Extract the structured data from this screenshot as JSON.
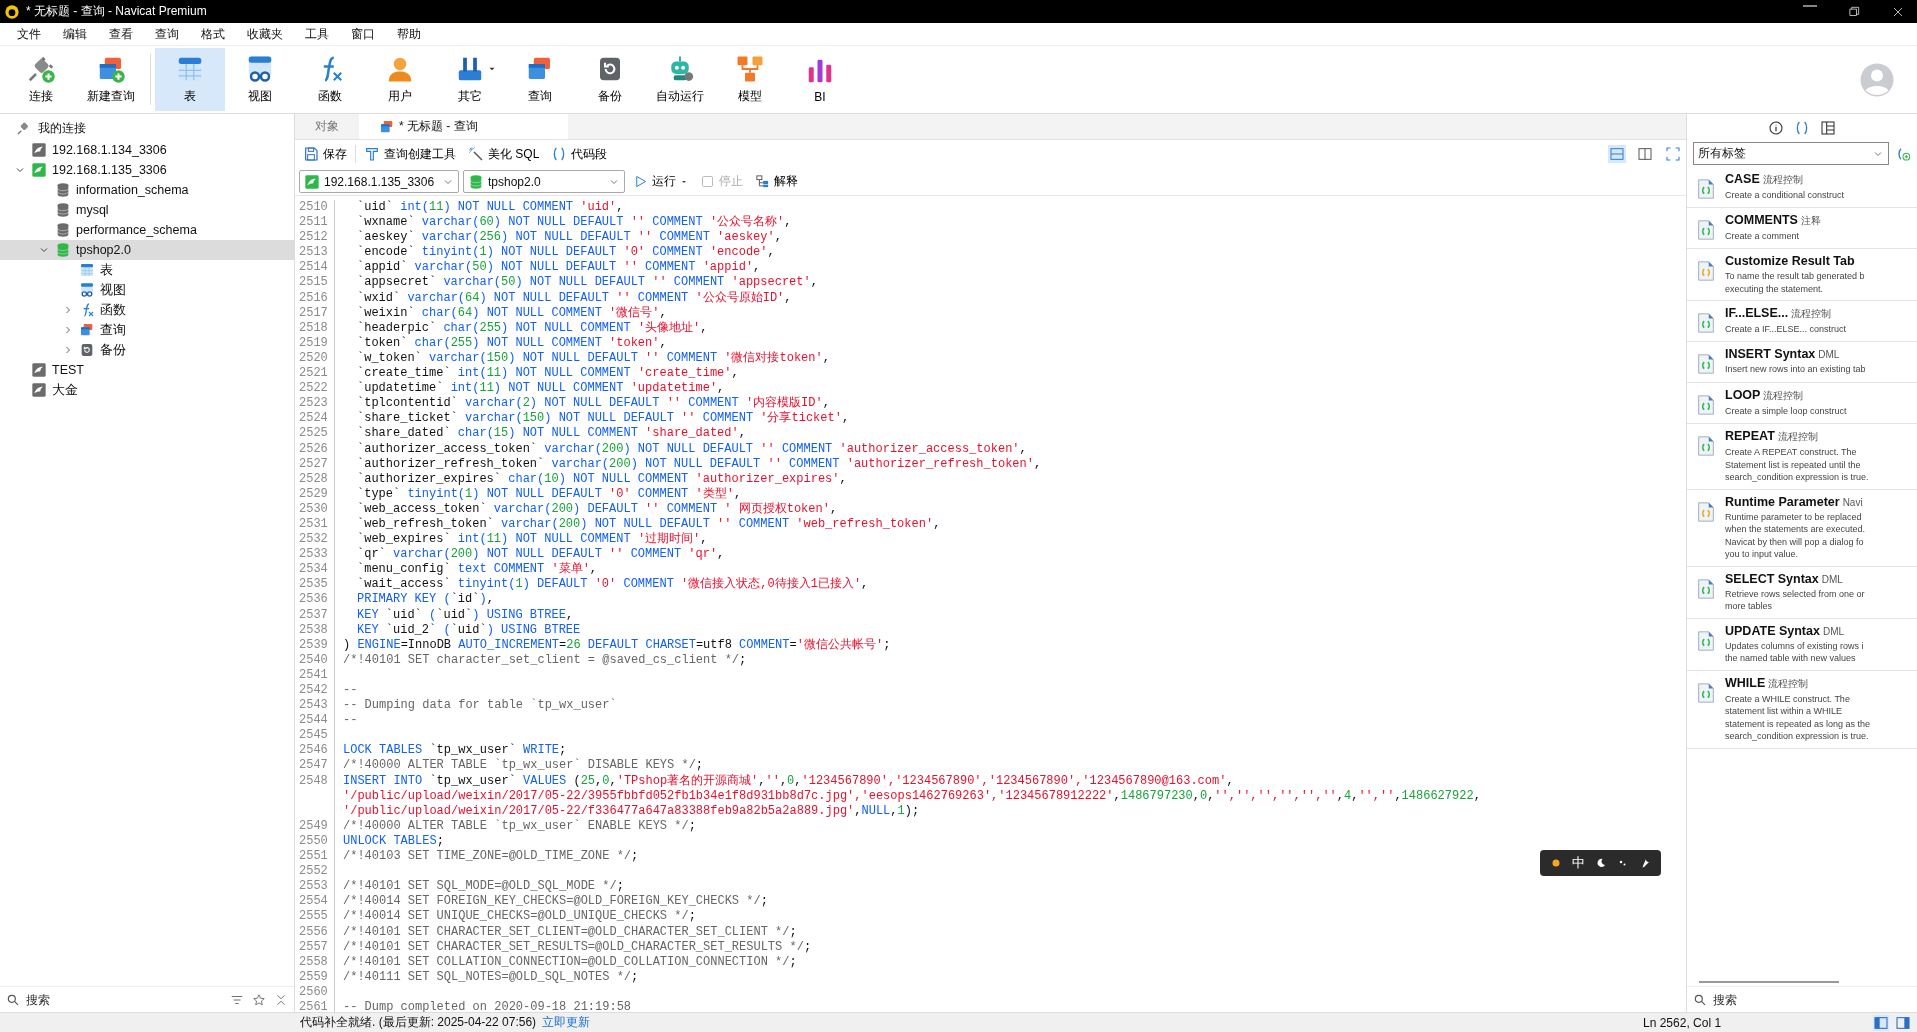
{
  "window": {
    "title": "* 无标题 - 查询 - Navicat Premium"
  },
  "menu": [
    "文件",
    "编辑",
    "查看",
    "查询",
    "格式",
    "收藏夹",
    "工具",
    "窗口",
    "帮助"
  ],
  "toolbar": [
    {
      "label": "连接",
      "kind": "connect",
      "selected": false,
      "dropdown": false
    },
    {
      "label": "新建查询",
      "kind": "new-query",
      "selected": false,
      "dropdown": false
    },
    {
      "label": "表",
      "kind": "table",
      "selected": true,
      "dropdown": false
    },
    {
      "label": "视图",
      "kind": "view",
      "selected": false,
      "dropdown": false
    },
    {
      "label": "函数",
      "kind": "function",
      "selected": false,
      "dropdown": false
    },
    {
      "label": "用户",
      "kind": "user",
      "selected": false,
      "dropdown": false
    },
    {
      "label": "其它",
      "kind": "other",
      "selected": false,
      "dropdown": true
    },
    {
      "label": "查询",
      "kind": "query",
      "selected": false,
      "dropdown": false
    },
    {
      "label": "备份",
      "kind": "backup",
      "selected": false,
      "dropdown": false
    },
    {
      "label": "自动运行",
      "kind": "automation",
      "selected": false,
      "dropdown": false
    },
    {
      "label": "模型",
      "kind": "model",
      "selected": false,
      "dropdown": false
    },
    {
      "label": "BI",
      "kind": "bi",
      "selected": false,
      "dropdown": false
    }
  ],
  "navigator": {
    "title": "我的连接",
    "items": [
      {
        "label": "192.168.1.134_3306",
        "kind": "server",
        "open": false,
        "selected": false
      },
      {
        "label": "192.168.1.135_3306",
        "kind": "server",
        "open": true,
        "selected": false,
        "expanded": true,
        "children": [
          {
            "label": "information_schema",
            "kind": "database",
            "open": false,
            "selected": false
          },
          {
            "label": "mysql",
            "kind": "database",
            "open": false,
            "selected": false
          },
          {
            "label": "performance_schema",
            "kind": "database",
            "open": false,
            "selected": false
          },
          {
            "label": "tpshop2.0",
            "kind": "database",
            "open": true,
            "selected": true,
            "expanded": true,
            "children": [
              {
                "label": "表",
                "kind": "table",
                "selected": false
              },
              {
                "label": "视图",
                "kind": "view",
                "selected": false
              },
              {
                "label": "函数",
                "kind": "function",
                "selected": false,
                "expanded": false
              },
              {
                "label": "查询",
                "kind": "query",
                "selected": false,
                "expanded": false
              },
              {
                "label": "备份",
                "kind": "backup",
                "selected": false,
                "expanded": false
              }
            ]
          }
        ]
      },
      {
        "label": "TEST",
        "kind": "server",
        "open": false,
        "selected": false
      },
      {
        "label": "大金",
        "kind": "server",
        "open": false,
        "selected": false
      }
    ],
    "search": {
      "placeholder": "搜索"
    }
  },
  "tabs": [
    {
      "label": "对象",
      "kind": "objects",
      "selected": false
    },
    {
      "label": "* 无标题 - 查询",
      "kind": "query",
      "selected": true
    }
  ],
  "editor_toolbar": [
    {
      "label": "保存",
      "kind": "save"
    },
    {
      "label": "查询创建工具",
      "kind": "builder"
    },
    {
      "label": "美化 SQL",
      "kind": "beautify"
    },
    {
      "label": "代码段",
      "kind": "snippet"
    }
  ],
  "connection_bar": {
    "connection": "192.168.1.135_3306",
    "database": "tpshop2.0",
    "run": "运行",
    "stop": {
      "label": "停止",
      "disabled": true
    },
    "explain": "解释"
  },
  "code": [
    {
      "number": "2510",
      "indent": true,
      "tokens": [
        {
          "kind": "plain",
          "text": "`uid` "
        },
        {
          "kind": "keyword",
          "text": "int("
        },
        {
          "kind": "number",
          "text": "11"
        },
        {
          "kind": "keyword",
          "text": ") NOT NULL COMMENT "
        },
        {
          "kind": "string",
          "text": "'uid'"
        },
        {
          "kind": "plain",
          "text": ","
        }
      ]
    },
    {
      "number": "2511",
      "indent": true,
      "tokens": [
        {
          "kind": "plain",
          "text": "`wxname` "
        },
        {
          "kind": "keyword",
          "text": "varchar("
        },
        {
          "kind": "number",
          "text": "60"
        },
        {
          "kind": "keyword",
          "text": ") NOT NULL DEFAULT "
        },
        {
          "kind": "string",
          "text": "''"
        },
        {
          "kind": "keyword",
          "text": " COMMENT "
        },
        {
          "kind": "string",
          "text": "'公众号名称'"
        },
        {
          "kind": "plain",
          "text": ","
        }
      ]
    },
    {
      "number": "2512",
      "indent": true,
      "tokens": [
        {
          "kind": "plain",
          "text": "`aeskey` "
        },
        {
          "kind": "keyword",
          "text": "varchar("
        },
        {
          "kind": "number",
          "text": "256"
        },
        {
          "kind": "keyword",
          "text": ") NOT NULL DEFAULT "
        },
        {
          "kind": "string",
          "text": "''"
        },
        {
          "kind": "keyword",
          "text": " COMMENT "
        },
        {
          "kind": "string",
          "text": "'aeskey'"
        },
        {
          "kind": "plain",
          "text": ","
        }
      ]
    },
    {
      "number": "2513",
      "indent": true,
      "tokens": [
        {
          "kind": "plain",
          "text": "`encode` "
        },
        {
          "kind": "keyword",
          "text": "tinyint("
        },
        {
          "kind": "number",
          "text": "1"
        },
        {
          "kind": "keyword",
          "text": ") NOT NULL DEFAULT "
        },
        {
          "kind": "string",
          "text": "'0'"
        },
        {
          "kind": "keyword",
          "text": " COMMENT "
        },
        {
          "kind": "string",
          "text": "'encode'"
        },
        {
          "kind": "plain",
          "text": ","
        }
      ]
    },
    {
      "number": "2514",
      "indent": true,
      "tokens": [
        {
          "kind": "plain",
          "text": "`appid` "
        },
        {
          "kind": "keyword",
          "text": "varchar("
        },
        {
          "kind": "number",
          "text": "50"
        },
        {
          "kind": "keyword",
          "text": ") NOT NULL DEFAULT "
        },
        {
          "kind": "string",
          "text": "''"
        },
        {
          "kind": "keyword",
          "text": " COMMENT "
        },
        {
          "kind": "string",
          "text": "'appid'"
        },
        {
          "kind": "plain",
          "text": ","
        }
      ]
    },
    {
      "number": "2515",
      "indent": true,
      "tokens": [
        {
          "kind": "plain",
          "text": "`appsecret` "
        },
        {
          "kind": "keyword",
          "text": "varchar("
        },
        {
          "kind": "number",
          "text": "50"
        },
        {
          "kind": "keyword",
          "text": ") NOT NULL DEFAULT "
        },
        {
          "kind": "string",
          "text": "''"
        },
        {
          "kind": "keyword",
          "text": " COMMENT "
        },
        {
          "kind": "string",
          "text": "'appsecret'"
        },
        {
          "kind": "plain",
          "text": ","
        }
      ]
    },
    {
      "number": "2516",
      "indent": true,
      "tokens": [
        {
          "kind": "plain",
          "text": "`wxid` "
        },
        {
          "kind": "keyword",
          "text": "varchar("
        },
        {
          "kind": "number",
          "text": "64"
        },
        {
          "kind": "keyword",
          "text": ") NOT NULL DEFAULT "
        },
        {
          "kind": "string",
          "text": "''"
        },
        {
          "kind": "keyword",
          "text": " COMMENT "
        },
        {
          "kind": "string",
          "text": "'公众号原始ID'"
        },
        {
          "kind": "plain",
          "text": ","
        }
      ]
    },
    {
      "number": "2517",
      "indent": true,
      "tokens": [
        {
          "kind": "plain",
          "text": "`weixin` "
        },
        {
          "kind": "keyword",
          "text": "char("
        },
        {
          "kind": "number",
          "text": "64"
        },
        {
          "kind": "keyword",
          "text": ") NOT NULL COMMENT "
        },
        {
          "kind": "string",
          "text": "'微信号'"
        },
        {
          "kind": "plain",
          "text": ","
        }
      ]
    },
    {
      "number": "2518",
      "indent": true,
      "tokens": [
        {
          "kind": "plain",
          "text": "`headerpic` "
        },
        {
          "kind": "keyword",
          "text": "char("
        },
        {
          "kind": "number",
          "text": "255"
        },
        {
          "kind": "keyword",
          "text": ") NOT NULL COMMENT "
        },
        {
          "kind": "string",
          "text": "'头像地址'"
        },
        {
          "kind": "plain",
          "text": ","
        }
      ]
    },
    {
      "number": "2519",
      "indent": true,
      "tokens": [
        {
          "kind": "plain",
          "text": "`token` "
        },
        {
          "kind": "keyword",
          "text": "char("
        },
        {
          "kind": "number",
          "text": "255"
        },
        {
          "kind": "keyword",
          "text": ") NOT NULL COMMENT "
        },
        {
          "kind": "string",
          "text": "'token'"
        },
        {
          "kind": "plain",
          "text": ","
        }
      ]
    },
    {
      "number": "2520",
      "indent": true,
      "tokens": [
        {
          "kind": "plain",
          "text": "`w_token` "
        },
        {
          "kind": "keyword",
          "text": "varchar("
        },
        {
          "kind": "number",
          "text": "150"
        },
        {
          "kind": "keyword",
          "text": ") NOT NULL DEFAULT "
        },
        {
          "kind": "string",
          "text": "''"
        },
        {
          "kind": "keyword",
          "text": " COMMENT "
        },
        {
          "kind": "string",
          "text": "'微信对接token'"
        },
        {
          "kind": "plain",
          "text": ","
        }
      ]
    },
    {
      "number": "2521",
      "indent": true,
      "tokens": [
        {
          "kind": "plain",
          "text": "`create_time` "
        },
        {
          "kind": "keyword",
          "text": "int("
        },
        {
          "kind": "number",
          "text": "11"
        },
        {
          "kind": "keyword",
          "text": ") NOT NULL COMMENT "
        },
        {
          "kind": "string",
          "text": "'create_time'"
        },
        {
          "kind": "plain",
          "text": ","
        }
      ]
    },
    {
      "number": "2522",
      "indent": true,
      "tokens": [
        {
          "kind": "plain",
          "text": "`updatetime` "
        },
        {
          "kind": "keyword",
          "text": "int("
        },
        {
          "kind": "number",
          "text": "11"
        },
        {
          "kind": "keyword",
          "text": ") NOT NULL COMMENT "
        },
        {
          "kind": "string",
          "text": "'updatetime'"
        },
        {
          "kind": "plain",
          "text": ","
        }
      ]
    },
    {
      "number": "2523",
      "indent": true,
      "tokens": [
        {
          "kind": "plain",
          "text": "`tplcontentid` "
        },
        {
          "kind": "keyword",
          "text": "varchar("
        },
        {
          "kind": "number",
          "text": "2"
        },
        {
          "kind": "keyword",
          "text": ") NOT NULL DEFAULT "
        },
        {
          "kind": "string",
          "text": "''"
        },
        {
          "kind": "keyword",
          "text": " COMMENT "
        },
        {
          "kind": "string",
          "text": "'内容模版ID'"
        },
        {
          "kind": "plain",
          "text": ","
        }
      ]
    },
    {
      "number": "2524",
      "indent": true,
      "tokens": [
        {
          "kind": "plain",
          "text": "`share_ticket` "
        },
        {
          "kind": "keyword",
          "text": "varchar("
        },
        {
          "kind": "number",
          "text": "150"
        },
        {
          "kind": "keyword",
          "text": ") NOT NULL DEFAULT "
        },
        {
          "kind": "string",
          "text": "''"
        },
        {
          "kind": "keyword",
          "text": " COMMENT "
        },
        {
          "kind": "string",
          "text": "'分享ticket'"
        },
        {
          "kind": "plain",
          "text": ","
        }
      ]
    },
    {
      "number": "2525",
      "indent": true,
      "tokens": [
        {
          "kind": "plain",
          "text": "`share_dated` "
        },
        {
          "kind": "keyword",
          "text": "char("
        },
        {
          "kind": "number",
          "text": "15"
        },
        {
          "kind": "keyword",
          "text": ") NOT NULL COMMENT "
        },
        {
          "kind": "string",
          "text": "'share_dated'"
        },
        {
          "kind": "plain",
          "text": ","
        }
      ]
    },
    {
      "number": "2526",
      "indent": true,
      "tokens": [
        {
          "kind": "plain",
          "text": "`authorizer_access_token` "
        },
        {
          "kind": "keyword",
          "text": "varchar("
        },
        {
          "kind": "number",
          "text": "200"
        },
        {
          "kind": "keyword",
          "text": ") NOT NULL DEFAULT "
        },
        {
          "kind": "string",
          "text": "''"
        },
        {
          "kind": "keyword",
          "text": " COMMENT "
        },
        {
          "kind": "string",
          "text": "'authorizer_access_token'"
        },
        {
          "kind": "plain",
          "text": ","
        }
      ]
    },
    {
      "number": "2527",
      "indent": true,
      "tokens": [
        {
          "kind": "plain",
          "text": "`authorizer_refresh_token` "
        },
        {
          "kind": "keyword",
          "text": "varchar("
        },
        {
          "kind": "number",
          "text": "200"
        },
        {
          "kind": "keyword",
          "text": ") NOT NULL DEFAULT "
        },
        {
          "kind": "string",
          "text": "''"
        },
        {
          "kind": "keyword",
          "text": " COMMENT "
        },
        {
          "kind": "string",
          "text": "'authorizer_refresh_token'"
        },
        {
          "kind": "plain",
          "text": ","
        }
      ]
    },
    {
      "number": "2528",
      "indent": true,
      "tokens": [
        {
          "kind": "plain",
          "text": "`authorizer_expires` "
        },
        {
          "kind": "keyword",
          "text": "char("
        },
        {
          "kind": "number",
          "text": "10"
        },
        {
          "kind": "keyword",
          "text": ") NOT NULL COMMENT "
        },
        {
          "kind": "string",
          "text": "'authorizer_expires'"
        },
        {
          "kind": "plain",
          "text": ","
        }
      ]
    },
    {
      "number": "2529",
      "indent": true,
      "tokens": [
        {
          "kind": "plain",
          "text": "`type` "
        },
        {
          "kind": "keyword",
          "text": "tinyint("
        },
        {
          "kind": "number",
          "text": "1"
        },
        {
          "kind": "keyword",
          "text": ") NOT NULL DEFAULT "
        },
        {
          "kind": "string",
          "text": "'0'"
        },
        {
          "kind": "keyword",
          "text": " COMMENT "
        },
        {
          "kind": "string",
          "text": "'类型'"
        },
        {
          "kind": "plain",
          "text": ","
        }
      ]
    },
    {
      "number": "2530",
      "indent": true,
      "tokens": [
        {
          "kind": "plain",
          "text": "`web_access_token` "
        },
        {
          "kind": "keyword",
          "text": "varchar("
        },
        {
          "kind": "number",
          "text": "200"
        },
        {
          "kind": "keyword",
          "text": ") DEFAULT "
        },
        {
          "kind": "string",
          "text": "''"
        },
        {
          "kind": "keyword",
          "text": " COMMENT "
        },
        {
          "kind": "string",
          "text": "' 网页授权token'"
        },
        {
          "kind": "plain",
          "text": ","
        }
      ]
    },
    {
      "number": "2531",
      "indent": true,
      "tokens": [
        {
          "kind": "plain",
          "text": "`web_refresh_token` "
        },
        {
          "kind": "keyword",
          "text": "varchar("
        },
        {
          "kind": "number",
          "text": "200"
        },
        {
          "kind": "keyword",
          "text": ") NOT NULL DEFAULT "
        },
        {
          "kind": "string",
          "text": "''"
        },
        {
          "kind": "keyword",
          "text": " COMMENT "
        },
        {
          "kind": "string",
          "text": "'web_refresh_token'"
        },
        {
          "kind": "plain",
          "text": ","
        }
      ]
    },
    {
      "number": "2532",
      "indent": true,
      "tokens": [
        {
          "kind": "plain",
          "text": "`web_expires` "
        },
        {
          "kind": "keyword",
          "text": "int("
        },
        {
          "kind": "number",
          "text": "11"
        },
        {
          "kind": "keyword",
          "text": ") NOT NULL COMMENT "
        },
        {
          "kind": "string",
          "text": "'过期时间'"
        },
        {
          "kind": "plain",
          "text": ","
        }
      ]
    },
    {
      "number": "2533",
      "indent": true,
      "tokens": [
        {
          "kind": "plain",
          "text": "`qr` "
        },
        {
          "kind": "keyword",
          "text": "varchar("
        },
        {
          "kind": "number",
          "text": "200"
        },
        {
          "kind": "keyword",
          "text": ") NOT NULL DEFAULT "
        },
        {
          "kind": "string",
          "text": "''"
        },
        {
          "kind": "keyword",
          "text": " COMMENT "
        },
        {
          "kind": "string",
          "text": "'qr'"
        },
        {
          "kind": "plain",
          "text": ","
        }
      ]
    },
    {
      "number": "2534",
      "indent": true,
      "tokens": [
        {
          "kind": "plain",
          "text": "`menu_config` "
        },
        {
          "kind": "keyword",
          "text": "text COMMENT "
        },
        {
          "kind": "string",
          "text": "'菜单'"
        },
        {
          "kind": "plain",
          "text": ","
        }
      ]
    },
    {
      "number": "2535",
      "indent": true,
      "tokens": [
        {
          "kind": "plain",
          "text": "`wait_access` "
        },
        {
          "kind": "keyword",
          "text": "tinyint("
        },
        {
          "kind": "number",
          "text": "1"
        },
        {
          "kind": "keyword",
          "text": ") DEFAULT "
        },
        {
          "kind": "string",
          "text": "'0'"
        },
        {
          "kind": "keyword",
          "text": " COMMENT "
        },
        {
          "kind": "string",
          "text": "'微信接入状态,0待接入1已接入'"
        },
        {
          "kind": "plain",
          "text": ","
        }
      ]
    },
    {
      "number": "2536",
      "indent": true,
      "tokens": [
        {
          "kind": "keyword",
          "text": "PRIMARY KEY ("
        },
        {
          "kind": "plain",
          "text": "`id`"
        },
        {
          "kind": "keyword",
          "text": ")"
        },
        {
          "kind": "plain",
          "text": ","
        }
      ]
    },
    {
      "number": "2537",
      "indent": true,
      "tokens": [
        {
          "kind": "keyword",
          "text": "KEY "
        },
        {
          "kind": "plain",
          "text": "`uid` "
        },
        {
          "kind": "keyword",
          "text": "("
        },
        {
          "kind": "plain",
          "text": "`uid`"
        },
        {
          "kind": "keyword",
          "text": ") USING BTREE"
        },
        {
          "kind": "plain",
          "text": ","
        }
      ]
    },
    {
      "number": "2538",
      "indent": true,
      "tokens": [
        {
          "kind": "keyword",
          "text": "KEY "
        },
        {
          "kind": "plain",
          "text": "`uid_2` "
        },
        {
          "kind": "keyword",
          "text": "("
        },
        {
          "kind": "plain",
          "text": "`uid`"
        },
        {
          "kind": "keyword",
          "text": ") USING BTREE"
        }
      ]
    },
    {
      "number": "2539",
      "indent": false,
      "tokens": [
        {
          "kind": "plain",
          "text": ") "
        },
        {
          "kind": "keyword",
          "text": "ENGINE"
        },
        {
          "kind": "plain",
          "text": "=InnoDB "
        },
        {
          "kind": "keyword",
          "text": "AUTO_INCREMENT"
        },
        {
          "kind": "plain",
          "text": "="
        },
        {
          "kind": "number",
          "text": "26"
        },
        {
          "kind": "keyword",
          "text": " DEFAULT CHARSET"
        },
        {
          "kind": "plain",
          "text": "=utf8 "
        },
        {
          "kind": "keyword",
          "text": "COMMENT"
        },
        {
          "kind": "plain",
          "text": "="
        },
        {
          "kind": "string",
          "text": "'微信公共帐号'"
        },
        {
          "kind": "plain",
          "text": ";"
        }
      ]
    },
    {
      "number": "2540",
      "indent": false,
      "tokens": [
        {
          "kind": "comment",
          "text": "/*!40101 SET character_set_client = @saved_cs_client */"
        },
        {
          "kind": "plain",
          "text": ";"
        }
      ]
    },
    {
      "number": "2541"
    },
    {
      "number": "2542",
      "indent": false,
      "tokens": [
        {
          "kind": "comment",
          "text": "--"
        }
      ]
    },
    {
      "number": "2543",
      "indent": false,
      "tokens": [
        {
          "kind": "comment",
          "text": "-- Dumping data for table `tp_wx_user`"
        }
      ]
    },
    {
      "number": "2544",
      "indent": false,
      "tokens": [
        {
          "kind": "comment",
          "text": "--"
        }
      ]
    },
    {
      "number": "2545"
    },
    {
      "number": "2546",
      "indent": false,
      "tokens": [
        {
          "kind": "keyword",
          "text": "LOCK TABLES "
        },
        {
          "kind": "plain",
          "text": "`tp_wx_user` "
        },
        {
          "kind": "keyword",
          "text": "WRITE"
        },
        {
          "kind": "plain",
          "text": ";"
        }
      ]
    },
    {
      "number": "2547",
      "indent": false,
      "tokens": [
        {
          "kind": "comment",
          "text": "/*!40000 ALTER TABLE `tp_wx_user` DISABLE KEYS */"
        },
        {
          "kind": "plain",
          "text": ";"
        }
      ]
    },
    {
      "number": "2548",
      "indent": false,
      "tokens": [
        {
          "kind": "keyword",
          "text": "INSERT INTO "
        },
        {
          "kind": "plain",
          "text": "`tp_wx_user` "
        },
        {
          "kind": "keyword",
          "text": "VALUES "
        },
        {
          "kind": "plain",
          "text": "("
        },
        {
          "kind": "number",
          "text": "25"
        },
        {
          "kind": "plain",
          "text": ","
        },
        {
          "kind": "number",
          "text": "0"
        },
        {
          "kind": "plain",
          "text": ","
        },
        {
          "kind": "string",
          "text": "'TPshop著名的开源商城'"
        },
        {
          "kind": "plain",
          "text": ","
        },
        {
          "kind": "string",
          "text": "''"
        },
        {
          "kind": "plain",
          "text": ","
        },
        {
          "kind": "number",
          "text": "0"
        },
        {
          "kind": "plain",
          "text": ","
        },
        {
          "kind": "string",
          "text": "'1234567890','1234567890','1234567890','1234567890@163.com'"
        },
        {
          "kind": "plain",
          "text": ","
        }
      ],
      "more": [
        [
          {
            "kind": "string",
            "text": "'/public/upload/weixin/2017/05-22/3955fbbfd052fb1b34e1f8d931bb8d7c.jpg','eesops1462769263','12345678912222'"
          },
          {
            "kind": "plain",
            "text": ","
          },
          {
            "kind": "number",
            "text": "1486797230"
          },
          {
            "kind": "plain",
            "text": ","
          },
          {
            "kind": "number",
            "text": "0"
          },
          {
            "kind": "plain",
            "text": ","
          },
          {
            "kind": "string",
            "text": "'','','','','',''"
          },
          {
            "kind": "plain",
            "text": ","
          },
          {
            "kind": "number",
            "text": "4"
          },
          {
            "kind": "plain",
            "text": ","
          },
          {
            "kind": "string",
            "text": "'',''"
          },
          {
            "kind": "plain",
            "text": ","
          },
          {
            "kind": "number",
            "text": "1486627922"
          },
          {
            "kind": "plain",
            "text": ","
          }
        ],
        [
          {
            "kind": "string",
            "text": "'/public/upload/weixin/2017/05-22/f336477a647a83388feb9a82b5a2a889.jpg'"
          },
          {
            "kind": "plain",
            "text": ","
          },
          {
            "kind": "keyword",
            "text": "NULL"
          },
          {
            "kind": "plain",
            "text": ","
          },
          {
            "kind": "number",
            "text": "1"
          },
          {
            "kind": "plain",
            "text": ");"
          }
        ]
      ]
    },
    {
      "number": "2549",
      "indent": false,
      "tokens": [
        {
          "kind": "comment",
          "text": "/*!40000 ALTER TABLE `tp_wx_user` ENABLE KEYS */"
        },
        {
          "kind": "plain",
          "text": ";"
        }
      ]
    },
    {
      "number": "2550",
      "indent": false,
      "tokens": [
        {
          "kind": "keyword",
          "text": "UNLOCK TABLES"
        },
        {
          "kind": "plain",
          "text": ";"
        }
      ]
    },
    {
      "number": "2551",
      "indent": false,
      "tokens": [
        {
          "kind": "comment",
          "text": "/*!40103 SET TIME_ZONE=@OLD_TIME_ZONE */"
        },
        {
          "kind": "plain",
          "text": ";"
        }
      ]
    },
    {
      "number": "2552"
    },
    {
      "number": "2553",
      "indent": false,
      "tokens": [
        {
          "kind": "comment",
          "text": "/*!40101 SET SQL_MODE=@OLD_SQL_MODE */"
        },
        {
          "kind": "plain",
          "text": ";"
        }
      ]
    },
    {
      "number": "2554",
      "indent": false,
      "tokens": [
        {
          "kind": "comment",
          "text": "/*!40014 SET FOREIGN_KEY_CHECKS=@OLD_FOREIGN_KEY_CHECKS */"
        },
        {
          "kind": "plain",
          "text": ";"
        }
      ]
    },
    {
      "number": "2555",
      "indent": false,
      "tokens": [
        {
          "kind": "comment",
          "text": "/*!40014 SET UNIQUE_CHECKS=@OLD_UNIQUE_CHECKS */"
        },
        {
          "kind": "plain",
          "text": ";"
        }
      ]
    },
    {
      "number": "2556",
      "indent": false,
      "tokens": [
        {
          "kind": "comment",
          "text": "/*!40101 SET CHARACTER_SET_CLIENT=@OLD_CHARACTER_SET_CLIENT */"
        },
        {
          "kind": "plain",
          "text": ";"
        }
      ]
    },
    {
      "number": "2557",
      "indent": false,
      "tokens": [
        {
          "kind": "comment",
          "text": "/*!40101 SET CHARACTER_SET_RESULTS=@OLD_CHARACTER_SET_RESULTS */"
        },
        {
          "kind": "plain",
          "text": ";"
        }
      ]
    },
    {
      "number": "2558",
      "indent": false,
      "tokens": [
        {
          "kind": "comment",
          "text": "/*!40101 SET COLLATION_CONNECTION=@OLD_COLLATION_CONNECTION */"
        },
        {
          "kind": "plain",
          "text": ";"
        }
      ]
    },
    {
      "number": "2559",
      "indent": false,
      "tokens": [
        {
          "kind": "comment",
          "text": "/*!40111 SET SQL_NOTES=@OLD_SQL_NOTES */"
        },
        {
          "kind": "plain",
          "text": ";"
        }
      ]
    },
    {
      "number": "2560"
    },
    {
      "number": "2561",
      "indent": false,
      "tokens": [
        {
          "kind": "comment",
          "text": "-- Dump completed on 2020-09-18 21:19:58"
        }
      ]
    }
  ],
  "ime_bar": {
    "label": "中"
  },
  "snippets": {
    "filter": "所有标签",
    "items": [
      {
        "title": "CASE",
        "tag": "流程控制",
        "description": [
          "Create a conditional construct"
        ],
        "color": "#2fb84a"
      },
      {
        "title": "COMMENTS",
        "tag": "注释",
        "description": [
          "Create a comment"
        ],
        "color": "#2fb84a"
      },
      {
        "title": "Customize Result Tab",
        "description": [
          "To name the result tab generated b",
          "executing the statement."
        ],
        "color": "#e8a820"
      },
      {
        "title": "IF...ELSE...",
        "tag": "流程控制",
        "description": [
          "Create a IF...ELSE... construct"
        ],
        "color": "#2fb84a"
      },
      {
        "title": "INSERT Syntax",
        "tag": "DML",
        "description": [
          "Insert new rows into an existing tab"
        ],
        "color": "#2fb84a"
      },
      {
        "title": "LOOP",
        "tag": "流程控制",
        "description": [
          "Create a simple loop construct"
        ],
        "color": "#2fb84a"
      },
      {
        "title": "REPEAT",
        "tag": "流程控制",
        "description": [
          "Create A REPEAT construct. The",
          "Statement list is repeated until the",
          "search_condition expression is true."
        ],
        "color": "#2fb84a"
      },
      {
        "title": "Runtime Parameter",
        "tag": "Navi",
        "description": [
          "Runtime parameter to be replaced",
          "when the statements are executed.",
          "Navicat by then will pop a dialog fo",
          "you to input value."
        ],
        "color": "#e8a820"
      },
      {
        "title": "SELECT Syntax",
        "tag": "DML",
        "description": [
          "Retrieve rows selected from one or",
          "more tables"
        ],
        "color": "#2fb84a"
      },
      {
        "title": "UPDATE Syntax",
        "tag": "DML",
        "description": [
          "Updates columns of existing rows i",
          "the named table with new values"
        ],
        "color": "#2fb84a"
      },
      {
        "title": "WHILE",
        "tag": "流程控制",
        "description": [
          "Create a WHILE construct. The",
          "statement list within a WHILE",
          "statement is repeated as long as the",
          "search_condition expression is true."
        ],
        "color": "#2fb84a"
      }
    ],
    "search": {
      "placeholder": "搜索"
    }
  },
  "status_bar": {
    "message": "代码补全就绪. (最后更新: 2025-04-22 07:56)",
    "link": "立即更新",
    "position": "Ln 2562, Col 1"
  }
}
